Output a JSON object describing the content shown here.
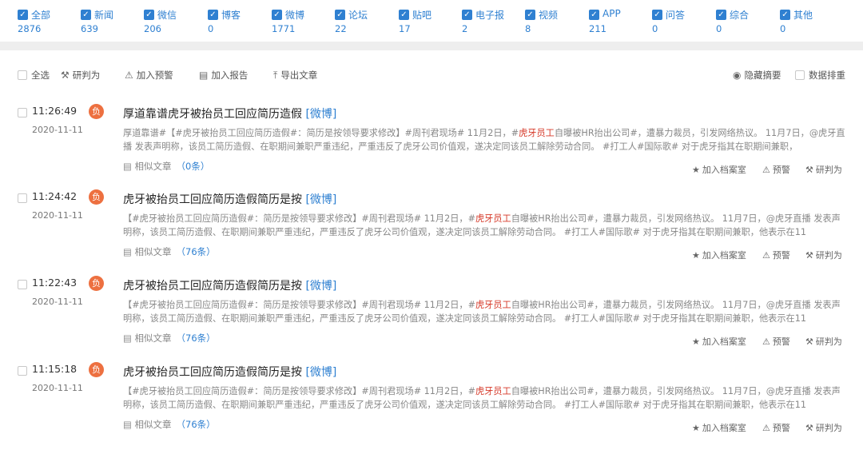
{
  "categories": [
    {
      "label": "全部",
      "count": "2876"
    },
    {
      "label": "新闻",
      "count": "639"
    },
    {
      "label": "微信",
      "count": "206"
    },
    {
      "label": "博客",
      "count": "0"
    },
    {
      "label": "微博",
      "count": "1771"
    },
    {
      "label": "论坛",
      "count": "22"
    },
    {
      "label": "贴吧",
      "count": "17"
    },
    {
      "label": "电子报",
      "count": "2"
    },
    {
      "label": "视频",
      "count": "8"
    },
    {
      "label": "APP",
      "count": "211"
    },
    {
      "label": "问答",
      "count": "0"
    },
    {
      "label": "综合",
      "count": "0"
    },
    {
      "label": "其他",
      "count": "0"
    }
  ],
  "toolbar": {
    "select_all": "全选",
    "judge": "研判为",
    "add_warning": "加入预警",
    "add_report": "加入报告",
    "export": "导出文章",
    "hide_summary": "隐藏摘要",
    "data_sort": "数据排重"
  },
  "items": [
    {
      "time": "11:26:49",
      "date": "2020-11-11",
      "badge": "负",
      "title": "厚道靠谱虎牙被抬员工回应简历造假",
      "source": "[微博]",
      "body_pre": "厚道靠谱#【#虎牙被抬员工回应简历造假#：简历是按领导要求修改】#周刊君现场# 11月2日，#",
      "highlight": "虎牙员工",
      "body_post": "自曝被HR抬出公司#，遭暴力裁员，引发网络热议。 11月7日，@虎牙直播 发表声明称，该员工简历造假、在职期间兼职严重违纪，严重违反了虎牙公司价值观，遂决定同该员工解除劳动合同。 #打工人#国际歌# 对于虎牙指其在职期间兼职，",
      "similar_label": "相似文章",
      "similar_count": "（0条）",
      "actions": {
        "archive": "加入档案室",
        "warn": "预警",
        "judge": "研判为"
      }
    },
    {
      "time": "11:24:42",
      "date": "2020-11-11",
      "badge": "负",
      "title": "虎牙被抬员工回应简历造假简历是按",
      "source": "[微博]",
      "body_pre": "【#虎牙被抬员工回应简历造假#：简历是按领导要求修改】#周刊君现场# 11月2日，#",
      "highlight": "虎牙员工",
      "body_post": "自曝被HR抬出公司#，遭暴力裁员，引发网络热议。 11月7日，@虎牙直播 发表声明称，该员工简历造假、在职期间兼职严重违纪，严重违反了虎牙公司价值观，遂决定同该员工解除劳动合同。 #打工人#国际歌# 对于虎牙指其在职期间兼职，他表示在11",
      "similar_label": "相似文章",
      "similar_count": "（76条）",
      "actions": {
        "archive": "加入档案室",
        "warn": "预警",
        "judge": "研判为"
      }
    },
    {
      "time": "11:22:43",
      "date": "2020-11-11",
      "badge": "负",
      "title": "虎牙被抬员工回应简历造假简历是按",
      "source": "[微博]",
      "body_pre": "【#虎牙被抬员工回应简历造假#：简历是按领导要求修改】#周刊君现场# 11月2日，#",
      "highlight": "虎牙员工",
      "body_post": "自曝被HR抬出公司#，遭暴力裁员，引发网络热议。 11月7日，@虎牙直播 发表声明称，该员工简历造假、在职期间兼职严重违纪，严重违反了虎牙公司价值观，遂决定同该员工解除劳动合同。 #打工人#国际歌# 对于虎牙指其在职期间兼职，他表示在11",
      "similar_label": "相似文章",
      "similar_count": "（76条）",
      "actions": {
        "archive": "加入档案室",
        "warn": "预警",
        "judge": "研判为"
      }
    },
    {
      "time": "11:15:18",
      "date": "2020-11-11",
      "badge": "负",
      "title": "虎牙被抬员工回应简历造假简历是按",
      "source": "[微博]",
      "body_pre": "【#虎牙被抬员工回应简历造假#：简历是按领导要求修改】#周刊君现场# 11月2日，#",
      "highlight": "虎牙员工",
      "body_post": "自曝被HR抬出公司#，遭暴力裁员，引发网络热议。 11月7日，@虎牙直播 发表声明称，该员工简历造假、在职期间兼职严重违纪，严重违反了虎牙公司价值观，遂决定同该员工解除劳动合同。 #打工人#国际歌# 对于虎牙指其在职期间兼职，他表示在11",
      "similar_label": "相似文章",
      "similar_count": "（76条）",
      "actions": {
        "archive": "加入档案室",
        "warn": "预警",
        "judge": "研判为"
      }
    }
  ]
}
